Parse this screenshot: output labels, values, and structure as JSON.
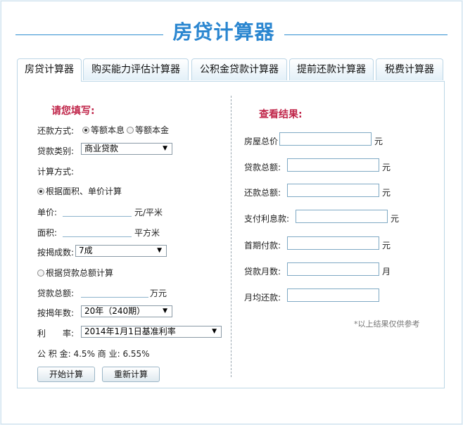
{
  "title": "房贷计算器",
  "tabs": [
    {
      "label": "房贷计算器",
      "active": true
    },
    {
      "label": "购买能力评估计算器",
      "active": false
    },
    {
      "label": "公积金贷款计算器",
      "active": false
    },
    {
      "label": "提前还款计算器",
      "active": false
    },
    {
      "label": "税费计算器",
      "active": false
    }
  ],
  "form": {
    "heading": "请您填写:",
    "repay_label": "还款方式:",
    "repay_opt1": "等额本息",
    "repay_opt2": "等额本金",
    "loan_type_label": "贷款类别:",
    "loan_type_value": "商业贷款",
    "calc_mode_label": "计算方式:",
    "mode_area": "根据面积、单价计算",
    "price_label": "单价:",
    "price_value": "",
    "price_unit": "元/平米",
    "area_label": "面积:",
    "area_value": "",
    "area_unit": "平方米",
    "ratio_label": "按揭成数:",
    "ratio_value": "7成",
    "mode_total": "根据贷款总额计算",
    "total_label": "贷款总额:",
    "total_value": "",
    "total_unit": "万元",
    "years_label": "按揭年数:",
    "years_value": "20年（240期）",
    "rate_label": "利　　率:",
    "rate_value": "2014年1月1日基准利率",
    "rate_info": "公 积 金:  4.5% 商 业:  6.55%",
    "start_btn": "开始计算",
    "reset_btn": "重新计算"
  },
  "result": {
    "heading": "查看结果:",
    "house_total_label": "房屋总价",
    "house_total_unit": "元",
    "loan_total_label": "贷款总额:",
    "loan_total_unit": "元",
    "repay_total_label": "还款总额:",
    "repay_total_unit": "元",
    "interest_label": "支付利息款:",
    "interest_unit": "元",
    "down_payment_label": "首期付款:",
    "down_payment_unit": "元",
    "months_label": "贷款月数:",
    "months_unit": "月",
    "monthly_label": "月均还款:",
    "note": "*以上结果仅供参考"
  }
}
